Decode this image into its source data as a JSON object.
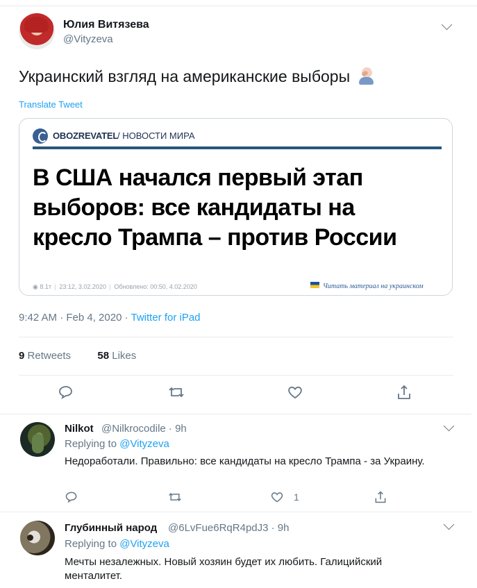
{
  "main_tweet": {
    "author": {
      "name": "Юлия Витязева",
      "handle": "@Vityzeva"
    },
    "text": "Украинский взгляд на американские выборы",
    "emoji_icon": "person-facepalming-icon",
    "translate_label": "Translate Tweet",
    "card": {
      "brand": "OBOZREVATEL",
      "section": "/ НОВОСТИ МИРА",
      "headline": "В США начался первый этап выборов: все кандидаты на кресло Трампа – против России",
      "views": "8.1т",
      "published": "23:12, 3.02.2020",
      "updated": "Обновлено: 00:50, 4.02.2020",
      "read_link": "Читать материал на украинском"
    },
    "timestamp": "9:42 AM · Feb 4, 2020 · ",
    "source": "Twitter for iPad",
    "stats": {
      "retweets_count": "9",
      "retweets_label": "Retweets",
      "likes_count": "58",
      "likes_label": "Likes"
    }
  },
  "replies": [
    {
      "author": {
        "name": "Nilkot",
        "handle": "@Nilkrocodile · 9h"
      },
      "replying_label": "Replying to ",
      "replying_handle": "@Vityzeva",
      "text": "Недоработали. Правильно: все кандидаты на кресло Трампа - за Украину.",
      "like_count": "1"
    },
    {
      "author": {
        "name": "Глубинный народ",
        "handle": "@6LvFue6RqR4pdJ3 · 9h"
      },
      "replying_label": "Replying to ",
      "replying_handle": "@Vityzeva",
      "text": "Мечты незалежных. Новый хозяин будет их любить. Галицийский менталитет."
    }
  ],
  "colors": {
    "accent": "#1da1f2",
    "muted": "#657786",
    "border": "#e6ecf0"
  }
}
